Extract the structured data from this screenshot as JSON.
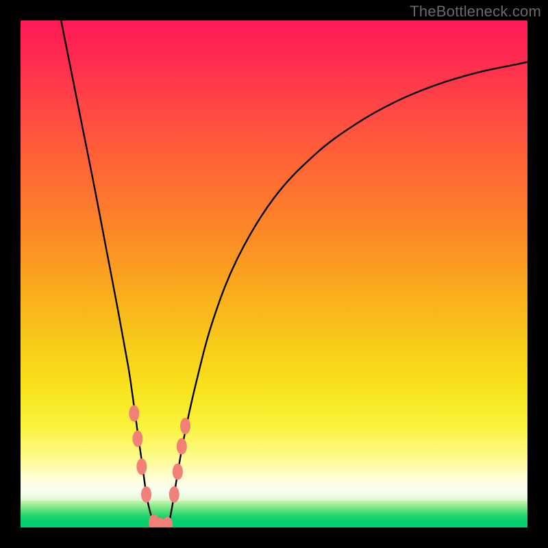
{
  "watermark": "TheBottleneck.com",
  "chart_data": {
    "type": "line",
    "title": "",
    "xlabel": "",
    "ylabel": "",
    "xlim": [
      0,
      100
    ],
    "ylim": [
      0,
      100
    ],
    "background_gradient": {
      "top_color": "#ff1957",
      "mid_colors": [
        "#fd7e2b",
        "#f8cf19",
        "#fefed0"
      ],
      "bottom_color": "#00d06c"
    },
    "series": [
      {
        "name": "bottleneck-curve",
        "color": "#000000",
        "x": [
          8.0,
          10.2,
          12.4,
          14.6,
          16.8,
          19.0,
          21.2,
          22.1,
          23.0,
          24.0,
          25.0,
          26.3,
          27.7,
          29.0,
          29.8,
          30.8,
          32.2,
          34.5,
          38.0,
          43.0,
          50.0,
          58.0,
          66.0,
          74.0,
          82.0,
          90.0,
          98.0,
          100.0
        ],
        "y": [
          100.0,
          89.0,
          78.0,
          67.0,
          55.5,
          44.0,
          32.0,
          26.0,
          19.5,
          12.5,
          5.5,
          1.0,
          0.2,
          0.2,
          3.5,
          9.5,
          17.5,
          28.0,
          41.0,
          53.5,
          65.0,
          73.5,
          79.5,
          84.0,
          87.3,
          89.7,
          91.4,
          91.8
        ]
      }
    ],
    "markers": [
      {
        "name": "left-cluster",
        "color": "#f08078",
        "points": [
          [
            22.4,
            22.5
          ],
          [
            23.1,
            17.5
          ],
          [
            23.9,
            12.0
          ],
          [
            24.8,
            6.5
          ]
        ]
      },
      {
        "name": "bottom-cluster",
        "color": "#f08078",
        "points": [
          [
            26.3,
            1.0
          ],
          [
            27.6,
            0.3
          ],
          [
            29.0,
            0.5
          ]
        ]
      },
      {
        "name": "right-cluster",
        "color": "#f08078",
        "points": [
          [
            30.3,
            6.5
          ],
          [
            31.0,
            11.0
          ],
          [
            31.8,
            16.0
          ],
          [
            32.5,
            20.0
          ]
        ]
      }
    ]
  }
}
